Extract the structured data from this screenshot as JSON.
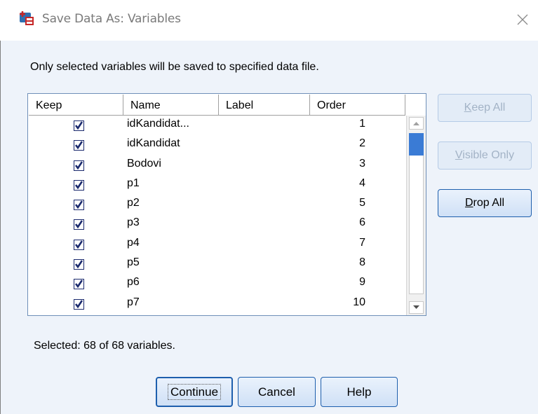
{
  "window": {
    "title": "Save Data As: Variables",
    "app_icon": "spss-save-icon",
    "close_icon": "close-icon"
  },
  "instruction": "Only selected variables will be saved to specified data file.",
  "table": {
    "columns": [
      "Keep",
      "Name",
      "Label",
      "Order"
    ],
    "rows": [
      {
        "keep": true,
        "name": "idKandidat...",
        "label": "",
        "order": "1"
      },
      {
        "keep": true,
        "name": "idKandidat",
        "label": "",
        "order": "2"
      },
      {
        "keep": true,
        "name": "Bodovi",
        "label": "",
        "order": "3"
      },
      {
        "keep": true,
        "name": "p1",
        "label": "",
        "order": "4"
      },
      {
        "keep": true,
        "name": "p2",
        "label": "",
        "order": "5"
      },
      {
        "keep": true,
        "name": "p3",
        "label": "",
        "order": "6"
      },
      {
        "keep": true,
        "name": "p4",
        "label": "",
        "order": "7"
      },
      {
        "keep": true,
        "name": "p5",
        "label": "",
        "order": "8"
      },
      {
        "keep": true,
        "name": "p6",
        "label": "",
        "order": "9"
      },
      {
        "keep": true,
        "name": "p7",
        "label": "",
        "order": "10"
      }
    ]
  },
  "side_buttons": {
    "keep_all": {
      "mnemonic": "K",
      "rest": "eep All",
      "enabled": false
    },
    "visible_only": {
      "mnemonic": "V",
      "rest": "isible Only",
      "enabled": false
    },
    "drop_all": {
      "mnemonic": "D",
      "rest": "rop All",
      "enabled": true
    }
  },
  "status": "Selected: 68 of 68 variables.",
  "buttons": {
    "continue": "Continue",
    "cancel": "Cancel",
    "help": "Help"
  },
  "colors": {
    "dialog_bg": "#eef3fa",
    "accent": "#1e5fad",
    "check": "#1b2a6e"
  }
}
